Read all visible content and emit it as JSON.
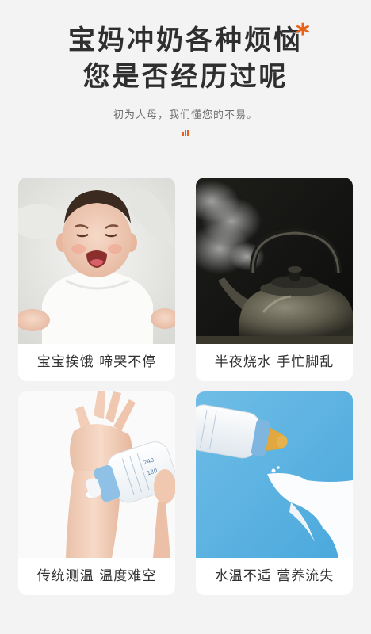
{
  "header": {
    "title_line1": "宝妈冲奶各种烦恼",
    "title_line2": "您是否经历过呢",
    "asterisk": "*",
    "subtitle": "初为人母，我们懂您的不易。",
    "accent_color": "#e8621b"
  },
  "cards": [
    {
      "caption": "宝宝挨饿 啼哭不停",
      "image": "crying-baby-photo"
    },
    {
      "caption": "半夜烧水 手忙脚乱",
      "image": "steaming-kettle-photo"
    },
    {
      "caption": "传统测温 温度难空",
      "image": "wrist-milk-test-photo"
    },
    {
      "caption": "水温不适 营养流失",
      "image": "spilled-milk-bottle-photo"
    }
  ]
}
